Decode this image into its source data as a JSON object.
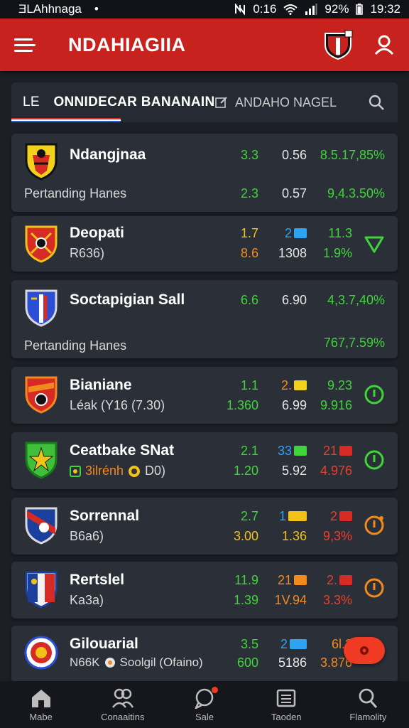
{
  "status": {
    "carrier": "ƎLAhhnaga",
    "dot": "•",
    "network": "0:16",
    "battery": "92%",
    "time": "19:32"
  },
  "app": {
    "title": "NDAHIAGIIA"
  },
  "filter": {
    "prefix": "LE",
    "left_tab": "ONNIDECAR BANANAIN",
    "right_tab": "ANDAHO NAGEL"
  },
  "teams": [
    {
      "name": "Ndangjnaa",
      "sub": "Pertanding Hanes",
      "row1": [
        "3.3",
        "0.56",
        "8.5.17,85%"
      ],
      "row2": [
        "2.3",
        "0.57",
        "9,4.3.50%"
      ],
      "colors": {
        "r1": [
          "green",
          "white",
          "green"
        ],
        "r2": [
          "green",
          "white",
          "green"
        ]
      },
      "crest": [
        "#f2d21b",
        "#d62a24",
        "#111111"
      ]
    },
    {
      "name": "Deopati",
      "sub": "R636)",
      "row1": [
        "1.7",
        "2",
        "11.3"
      ],
      "row2": [
        "8.6",
        "1308",
        "1.9%"
      ],
      "colors": {
        "r1": [
          "yellow",
          "blue",
          "green"
        ],
        "r2": [
          "orange",
          "white",
          "green"
        ]
      },
      "swatch1": "#2ea3f2",
      "action": "triangle",
      "action_color": "#3fd43a",
      "crest": [
        "#d62a24",
        "#f2c21b",
        "#ffffff"
      ]
    },
    {
      "name": "Soctapigian Sall",
      "sub": "Pertanding Hanes",
      "row1": [
        "6.6",
        "6.90",
        "4,3.7,40%"
      ],
      "row2": [
        "",
        "",
        "767,7.59%"
      ],
      "colors": {
        "r1": [
          "green",
          "white",
          "green"
        ],
        "r2": [
          "green",
          "white",
          "green"
        ]
      },
      "crest": [
        "#2a4fd6",
        "#d62a24",
        "#ffffff"
      ]
    },
    {
      "name": "Bianiane",
      "sub": "Léak (Y16 (7.30)",
      "row1": [
        "1.1",
        "2.",
        "9.23"
      ],
      "row2": [
        "1.360",
        "6.99",
        "9.916"
      ],
      "colors": {
        "r1": [
          "green",
          "orange",
          "green"
        ],
        "r2": [
          "green",
          "white",
          "green"
        ]
      },
      "swatch1": "#f2d21b",
      "action": "power",
      "action_color": "#3fd43a",
      "crest": [
        "#d62a24",
        "#f28a1e",
        "#111111"
      ]
    },
    {
      "name": "Ceatbake SNat",
      "sub": "3ilrénh",
      "sub2": "D0)",
      "row1": [
        "2.1",
        "33",
        "21"
      ],
      "row2": [
        "1.20",
        "5.92",
        "4.976"
      ],
      "colors": {
        "r1": [
          "green",
          "blue",
          "red"
        ],
        "r2": [
          "green",
          "white",
          "red"
        ]
      },
      "swatch1": "#3fd43a",
      "swatch3": "#d62a24",
      "action": "power",
      "action_color": "#3fd43a",
      "crest": [
        "#3fbf3a",
        "#f2c21b",
        "#1a7a1a"
      ]
    },
    {
      "name": "Sorrennal",
      "sub": "B6a6)",
      "row1": [
        "2.7",
        "1",
        "2"
      ],
      "row2": [
        "3.00",
        "1.36",
        "9,3%"
      ],
      "colors": {
        "r1": [
          "green",
          "blue",
          "red"
        ],
        "r2": [
          "green",
          "white",
          "red"
        ]
      },
      "swatch1": "#f2c21b",
      "swatch3": "#d62a24",
      "action": "power",
      "action_color": "#f28a1e",
      "crest": [
        "#1a3f9c",
        "#d62a24",
        "#ffffff"
      ]
    },
    {
      "name": "Rertslel",
      "sub": "Ka3a)",
      "row1": [
        "11.9",
        "21",
        "2."
      ],
      "row2": [
        "1.39",
        "1V.94",
        "3.3%"
      ],
      "colors": {
        "r1": [
          "green",
          "orange",
          "red"
        ],
        "r2": [
          "green",
          "orange",
          "red"
        ]
      },
      "swatch1": "#f28a1e",
      "swatch3": "#d62a24",
      "action": "power",
      "action_color": "#f28a1e",
      "crest": [
        "#1a3f9c",
        "#d62a24",
        "#f2f2f2"
      ]
    },
    {
      "name": "Gilouarial",
      "sub": "N66K",
      "sub2": "Soolgil (Ofaino)",
      "row1": [
        "3.5",
        "2",
        "6l.3"
      ],
      "row2": [
        "600",
        "5186",
        "3.876"
      ],
      "colors": {
        "r1": [
          "green",
          "blue",
          "orange"
        ],
        "r2": [
          "green",
          "white",
          "orange"
        ]
      },
      "swatch1": "#2ea3f2",
      "crest": [
        "#ffffff",
        "#d62a24",
        "#2a4fd6"
      ]
    }
  ],
  "nav": [
    {
      "label": "Mabe",
      "icon": "home-icon"
    },
    {
      "label": "Conaaitins",
      "icon": "users-icon"
    },
    {
      "label": "Sale",
      "icon": "chat-icon"
    },
    {
      "label": "Taoden",
      "icon": "list-icon"
    },
    {
      "label": "Flamolity",
      "icon": "search-icon"
    }
  ]
}
